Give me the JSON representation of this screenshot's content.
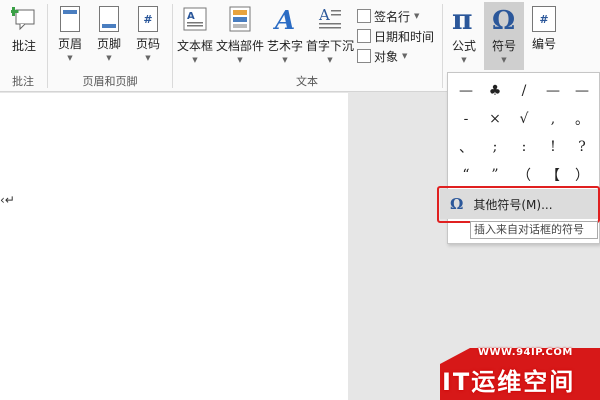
{
  "ribbon": {
    "comment_group": {
      "button_label": "批注",
      "group_label": "批注"
    },
    "header_footer_group": {
      "header_label": "页眉",
      "footer_label": "页脚",
      "pagenum_label": "页码",
      "group_label": "页眉和页脚"
    },
    "text_group": {
      "textbox_label": "文本框",
      "quickparts_label": "文档部件",
      "wordart_label": "艺术字",
      "dropcap_label": "首字下沉",
      "signature_label": "签名行",
      "datetime_label": "日期和时间",
      "object_label": "对象",
      "group_label": "文本"
    },
    "symbols_group": {
      "equation_label": "公式",
      "symbol_label": "符号",
      "number_label": "编号"
    }
  },
  "symbol_dropdown": {
    "symbols": [
      "—",
      "♣",
      "/",
      "—",
      "—",
      "-",
      "×",
      "√",
      ",",
      "。",
      "、",
      ";",
      ":",
      "!",
      "?",
      "“",
      "”",
      "（",
      "【",
      "）"
    ],
    "more_symbols_label": "其他符号(M)...",
    "tooltip": "插入来自对话框的符号"
  },
  "watermark": {
    "url": "WWW.94IP.COM",
    "text": "IT运维空间"
  },
  "colors": {
    "accent_blue": "#2b579a",
    "highlight_red": "#e02020",
    "watermark_red": "#d71818"
  }
}
